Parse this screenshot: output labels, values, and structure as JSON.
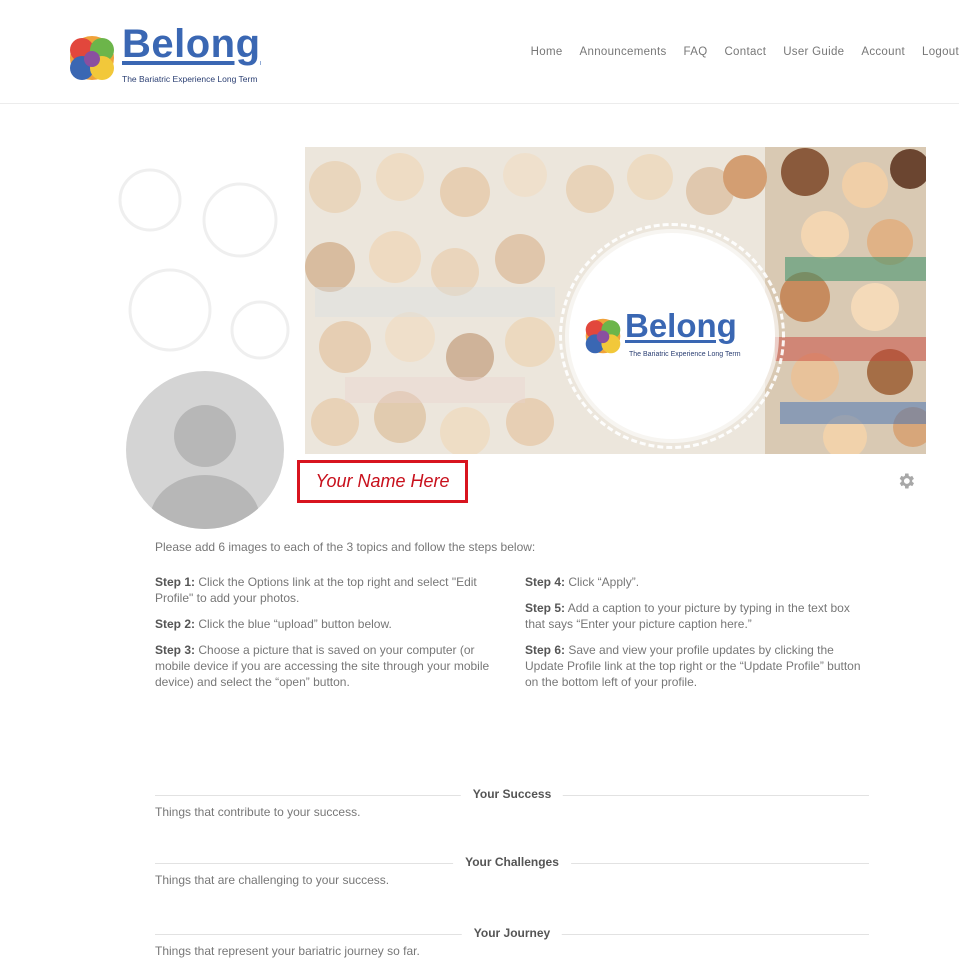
{
  "header": {
    "logo_text": "Belong",
    "logo_tagline": "The Bariatric Experience Long Term",
    "nav": [
      "Home",
      "Announcements",
      "FAQ",
      "Contact",
      "User Guide",
      "Account",
      "Logout"
    ]
  },
  "banner": {
    "logo_text": "Belong",
    "logo_tagline": "The Bariatric Experience Long Term"
  },
  "profile": {
    "name": "Your Name Here"
  },
  "instructions": {
    "intro": "Please add 6 images to each of the 3 topics and follow the steps below:",
    "steps": [
      {
        "label": "Step 1:",
        "text": " Click the Options link at the top right and select \"Edit Profile\" to add your photos."
      },
      {
        "label": "Step 2:",
        "text": " Click the blue “upload” button below."
      },
      {
        "label": "Step 3:",
        "text": " Choose a picture that is saved on your computer (or mobile device if you are accessing the site through your mobile device) and select the “open” button."
      },
      {
        "label": "Step 4:",
        "text": " Click “Apply”."
      },
      {
        "label": "Step 5:",
        "text": " Add a caption to your picture by typing in the text box that says “Enter your picture caption here.”"
      },
      {
        "label": "Step 6:",
        "text": " Save and view your profile updates by clicking the Update Profile link at the top right or the “Update Profile” button on the bottom left of your profile."
      }
    ]
  },
  "sections": [
    {
      "title": "Your Success",
      "desc": "Things that contribute to your success."
    },
    {
      "title": "Your Challenges",
      "desc": "Things that are challenging to your success."
    },
    {
      "title": "Your Journey",
      "desc": "Things that represent your bariatric journey so far."
    }
  ],
  "colors": {
    "brand_blue": "#3a67b3",
    "name_red": "#c8101c"
  }
}
